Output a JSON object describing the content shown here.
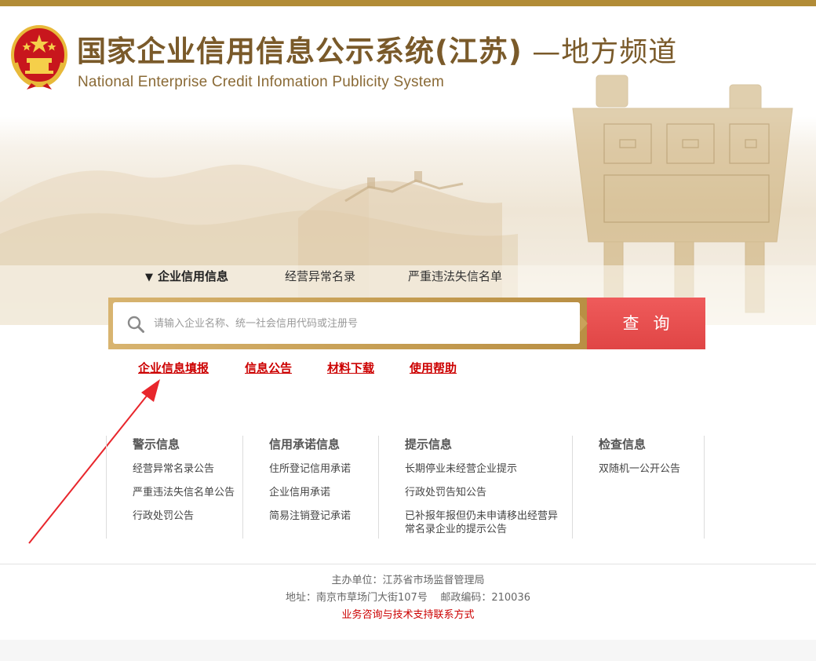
{
  "header": {
    "title_main": "国家企业信用信息公示系统(江苏)",
    "title_suffix": " —地方频道",
    "title_en": "National Enterprise Credit Infomation Publicity System"
  },
  "search": {
    "tabs": [
      {
        "label": "企业信用信息",
        "active": true,
        "arrow": "▼"
      },
      {
        "label": "经营异常名录",
        "active": false
      },
      {
        "label": "严重违法失信名单",
        "active": false
      }
    ],
    "placeholder": "请输入企业名称、统一社会信用代码或注册号",
    "button_label": "查询"
  },
  "quick_links": [
    {
      "label": "企业信息填报"
    },
    {
      "label": "信息公告"
    },
    {
      "label": "材料下载"
    },
    {
      "label": "使用帮助"
    }
  ],
  "columns": [
    {
      "title": "警示信息",
      "items": [
        "经营异常名录公告",
        "严重违法失信名单公告",
        "行政处罚公告"
      ]
    },
    {
      "title": "信用承诺信息",
      "items": [
        "住所登记信用承诺",
        "企业信用承诺",
        "简易注销登记承诺"
      ]
    },
    {
      "title": "提示信息",
      "items": [
        "长期停业未经营企业提示",
        "行政处罚告知公告",
        "已补报年报但仍未申请移出经营异常名录企业的提示公告"
      ]
    },
    {
      "title": "检查信息",
      "items": [
        "双随机一公开公告"
      ]
    }
  ],
  "footer": {
    "sponsor": "主办单位：江苏省市场监督管理局",
    "address": "地址：南京市草场门大街107号    邮政编码：210036",
    "contact_link": "业务咨询与技术支持联系方式"
  },
  "colors": {
    "gold": "#b28c37",
    "search_button": "#e04545",
    "link_red": "#cc0000",
    "annotation_arrow": "#e8262c"
  }
}
